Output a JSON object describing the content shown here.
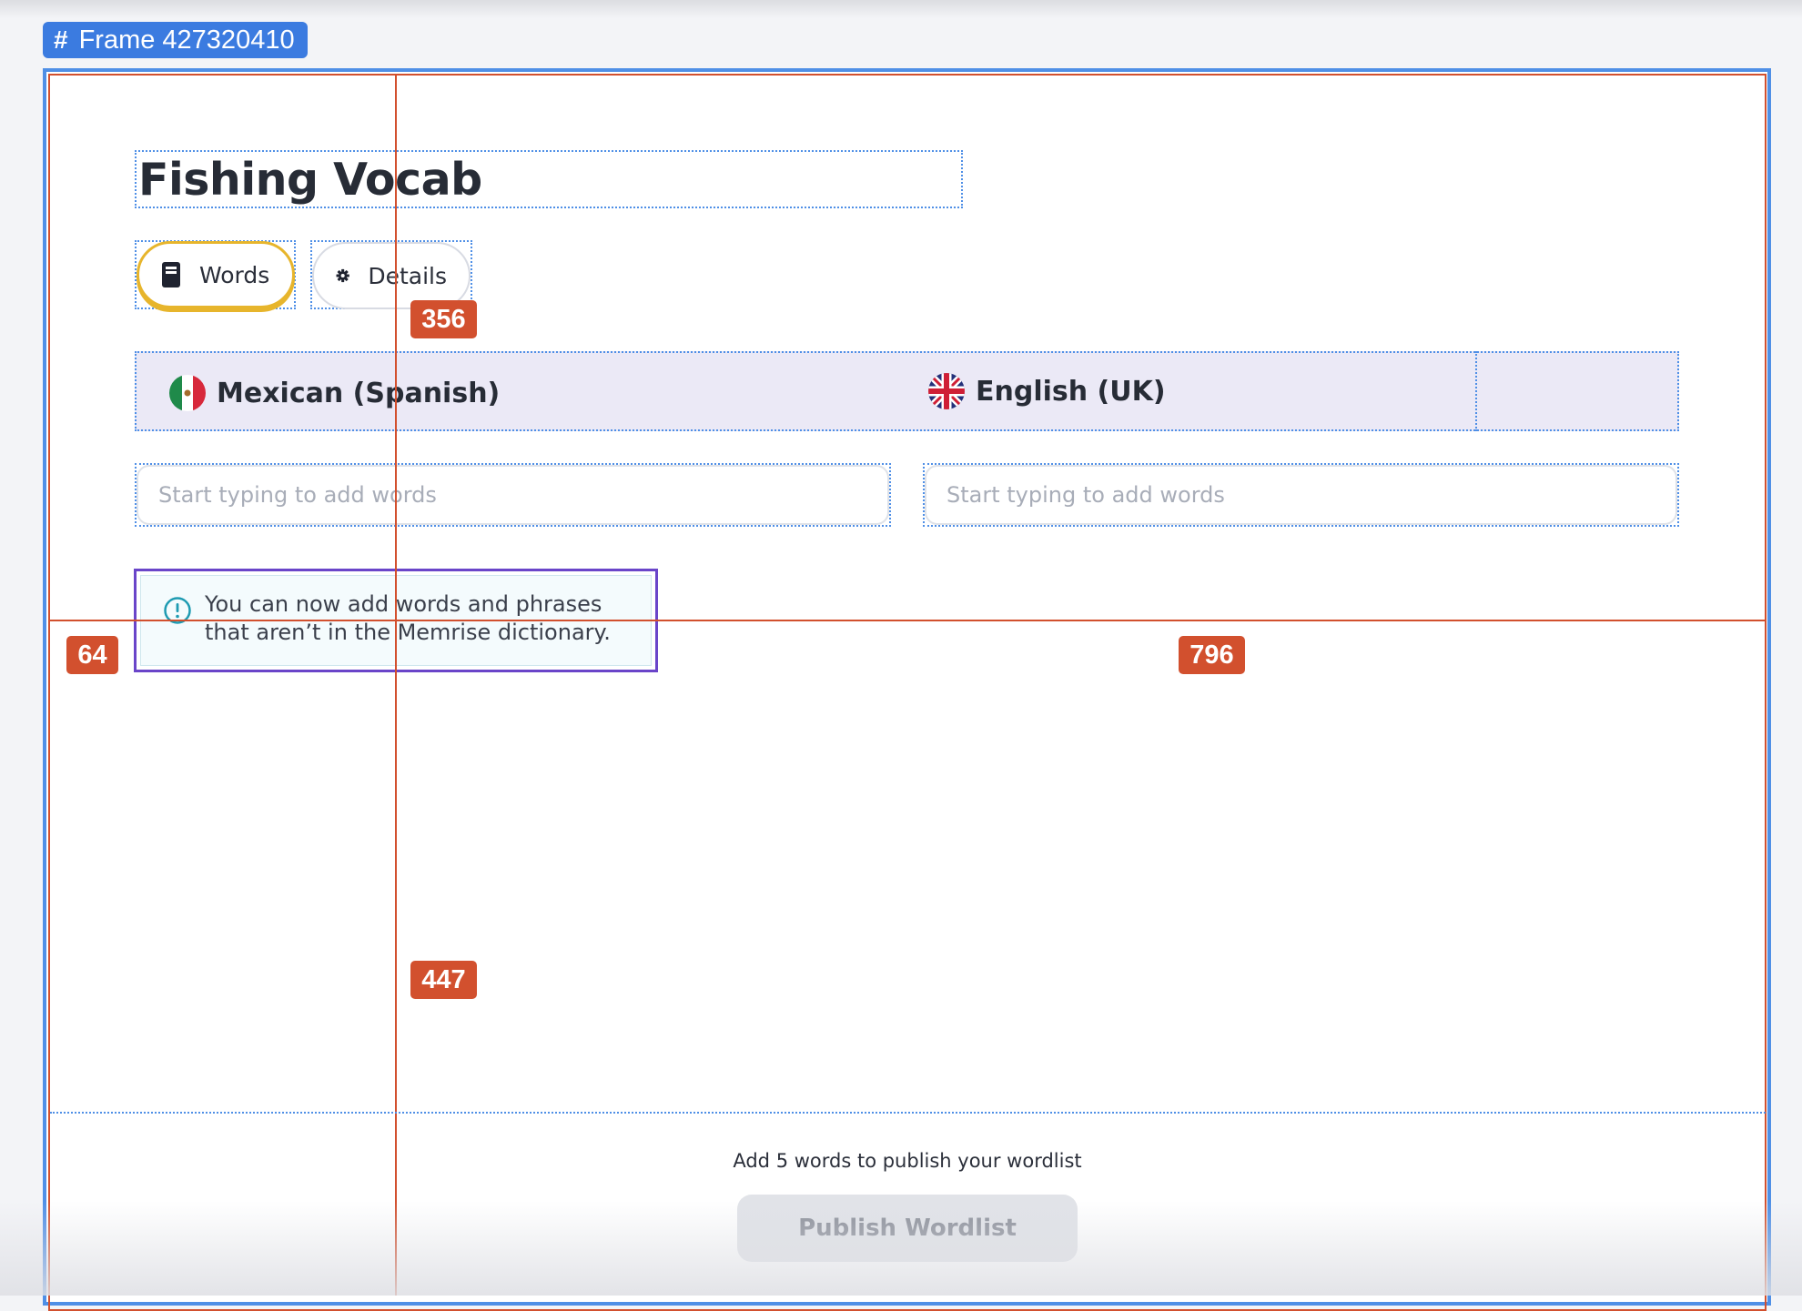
{
  "frame": {
    "label": "Frame 427320410",
    "icon": "hash-icon",
    "accent": "#3b7be0"
  },
  "wordlist": {
    "title": "Fishing Vocab",
    "tabs": [
      {
        "label": "Words",
        "icon": "book-icon",
        "active": true
      },
      {
        "label": "Details",
        "icon": "gear-icon",
        "active": false
      }
    ]
  },
  "languages": {
    "source": {
      "label": "Mexican (Spanish)",
      "flag": "mexico-flag-icon"
    },
    "target": {
      "label": "English (UK)",
      "flag": "uk-flag-icon"
    }
  },
  "inputs": {
    "source_placeholder": "Start typing to add words",
    "target_placeholder": "Start typing to add words"
  },
  "tip": {
    "line1": "You can now add words and phrases",
    "line2": "that aren’t in the Memrise dictionary.",
    "icon": "info-icon"
  },
  "measurements": {
    "a": "356",
    "b": "64",
    "c": "796",
    "d": "447",
    "color": "#d2502e"
  },
  "footer": {
    "note": "Add 5 words to publish your wordlist",
    "publish_label": "Publish Wordlist"
  }
}
